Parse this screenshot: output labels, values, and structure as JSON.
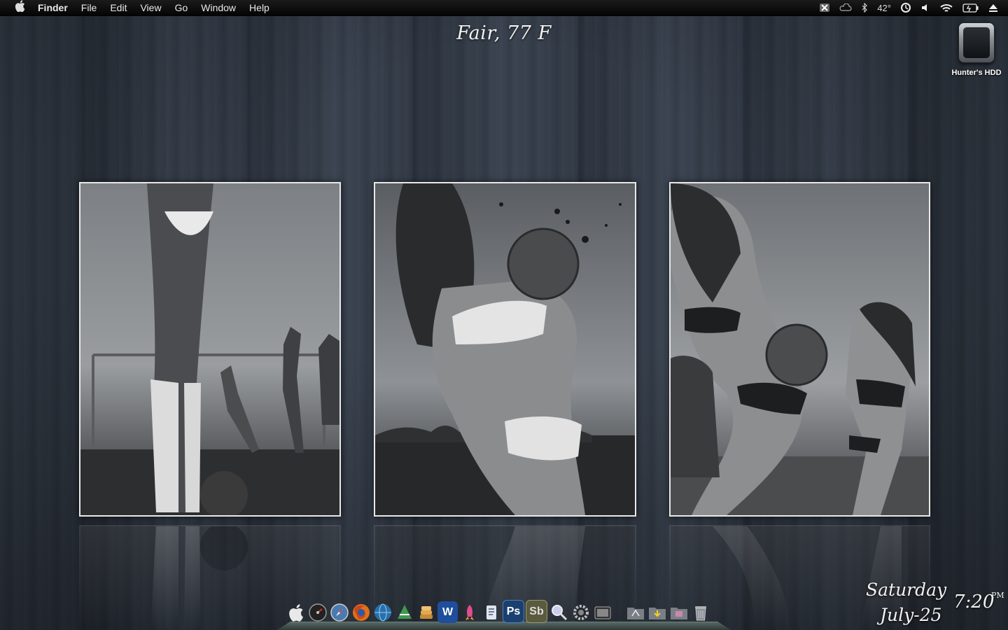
{
  "menubar": {
    "apple_icon": "apple-icon",
    "app_name": "Finder",
    "menus": [
      "File",
      "Edit",
      "View",
      "Go",
      "Window",
      "Help"
    ],
    "status": {
      "icons": [
        "x-app-icon",
        "cloud-icon",
        "bluetooth-icon",
        "time-machine-icon",
        "volume-icon",
        "wifi-icon",
        "battery-icon",
        "eject-icon"
      ],
      "temperature": "42°"
    }
  },
  "weather": {
    "text": "Fair, 77 F"
  },
  "desktop": {
    "drive_label": "Hunter's HDD",
    "drive_icon": "hard-drive-icon"
  },
  "photos": [
    {
      "name": "photo-left",
      "description_icon": "photo-icon"
    },
    {
      "name": "photo-center",
      "description_icon": "photo-icon"
    },
    {
      "name": "photo-right",
      "description_icon": "photo-icon"
    }
  ],
  "dock": {
    "icons": [
      "finder-icon",
      "dashboard-icon",
      "safari-icon",
      "firefox-icon",
      "network-icon",
      "vlc-icon",
      "stack-icon",
      "word-icon",
      "rocket-icon",
      "script-icon",
      "photoshop-icon",
      "soundbooth-icon",
      "preview-icon",
      "system-preferences-icon",
      "photo-booth-icon",
      "applications-folder-icon",
      "downloads-folder-icon",
      "pictures-folder-icon",
      "trash-icon"
    ],
    "photoshop_text": "Ps",
    "soundbooth_text": "Sb",
    "word_text": "W"
  },
  "clock": {
    "day": "Saturday",
    "date": "July-25",
    "time": "7:20",
    "ampm": "PM"
  },
  "colors": {
    "menubar_bg": "#0a0a0a",
    "desktop_bg": "#333b47",
    "frame_border": "#e8e8e8"
  }
}
